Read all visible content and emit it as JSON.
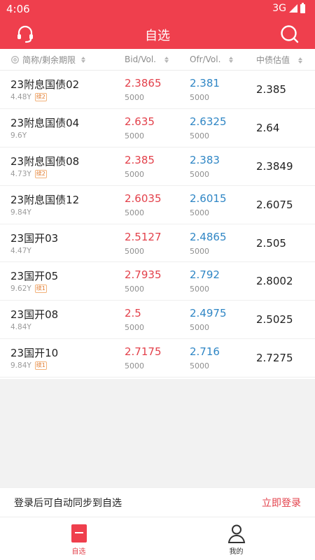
{
  "status_bar": {
    "time": "4:06",
    "network": "3G"
  },
  "header": {
    "title": "自选",
    "left_icon": "headset-icon",
    "right_icon": "search-icon",
    "color": "#ef3f4d"
  },
  "table": {
    "columns": {
      "name": "简称/剩余期限",
      "bid": "Bid/Vol.",
      "ofr": "Ofr/Vol.",
      "valuation": "中债估值"
    },
    "rows": [
      {
        "name": "23附息国债02",
        "term": "4.48Y",
        "tag": "续2",
        "bid": "2.3865",
        "bid_vol": "5000",
        "ofr": "2.381",
        "ofr_vol": "5000",
        "val": "2.385"
      },
      {
        "name": "23附息国债04",
        "term": "9.6Y",
        "tag": "",
        "bid": "2.635",
        "bid_vol": "5000",
        "ofr": "2.6325",
        "ofr_vol": "5000",
        "val": "2.64"
      },
      {
        "name": "23附息国债08",
        "term": "4.73Y",
        "tag": "续2",
        "bid": "2.385",
        "bid_vol": "5000",
        "ofr": "2.383",
        "ofr_vol": "5000",
        "val": "2.3849"
      },
      {
        "name": "23附息国债12",
        "term": "9.84Y",
        "tag": "",
        "bid": "2.6035",
        "bid_vol": "5000",
        "ofr": "2.6015",
        "ofr_vol": "5000",
        "val": "2.6075"
      },
      {
        "name": "23国开03",
        "term": "4.47Y",
        "tag": "",
        "bid": "2.5127",
        "bid_vol": "5000",
        "ofr": "2.4865",
        "ofr_vol": "5000",
        "val": "2.505"
      },
      {
        "name": "23国开05",
        "term": "9.62Y",
        "tag": "续1",
        "bid": "2.7935",
        "bid_vol": "5000",
        "ofr": "2.792",
        "ofr_vol": "5000",
        "val": "2.8002"
      },
      {
        "name": "23国开08",
        "term": "4.84Y",
        "tag": "",
        "bid": "2.5",
        "bid_vol": "5000",
        "ofr": "2.4975",
        "ofr_vol": "5000",
        "val": "2.5025"
      },
      {
        "name": "23国开10",
        "term": "9.84Y",
        "tag": "续1",
        "bid": "2.7175",
        "bid_vol": "5000",
        "ofr": "2.716",
        "ofr_vol": "5000",
        "val": "2.7275"
      }
    ]
  },
  "login_prompt": {
    "message": "登录后可自动同步到自选",
    "action": "立即登录"
  },
  "tabbar": {
    "items": [
      {
        "label": "自选",
        "icon": "bookmark-icon"
      },
      {
        "label": "我的",
        "icon": "user-icon"
      }
    ]
  },
  "colors": {
    "brand": "#ef3f4d",
    "bid": "#e3414b",
    "ofr": "#2f86c5"
  }
}
